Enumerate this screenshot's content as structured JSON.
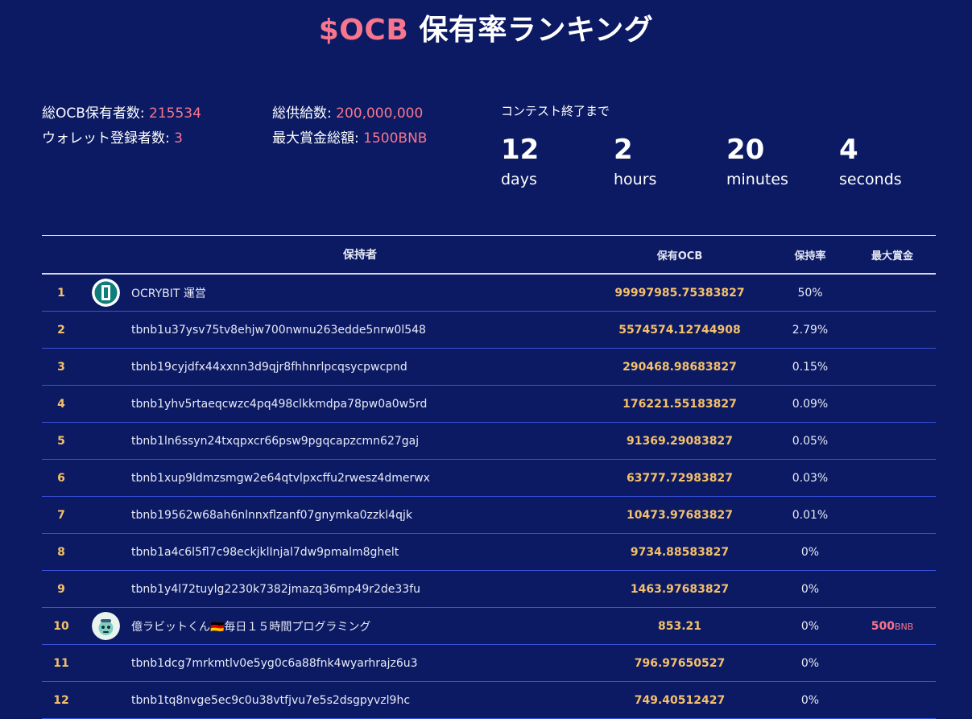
{
  "header": {
    "title_accent": "$OCB",
    "title_rest": "保有率ランキング"
  },
  "stats": {
    "total_holders_label": "総OCB保有者数: ",
    "total_holders_value": "215534",
    "wallet_registered_label": "ウォレット登録者数: ",
    "wallet_registered_value": "3",
    "total_supply_label": "総供給数: ",
    "total_supply_value": "200,000,000",
    "max_prize_label": "最大賞金総額: ",
    "max_prize_value": "1500BNB"
  },
  "countdown": {
    "label": "コンテスト終了まで",
    "units": [
      {
        "num": "12",
        "name": "days"
      },
      {
        "num": "2",
        "name": "hours"
      },
      {
        "num": "20",
        "name": "minutes"
      },
      {
        "num": "4",
        "name": "seconds"
      }
    ]
  },
  "table": {
    "headers": {
      "holder": "保持者",
      "holding": "保有OCB",
      "rate": "保持率",
      "prize": "最大賞金"
    },
    "rows": [
      {
        "rank": "1",
        "avatar": "ocrybit-logo-icon",
        "name": "OCRYBIT 運営",
        "holding": "99997985.75383827",
        "rate": "50%",
        "prize_amount": "",
        "prize_currency": ""
      },
      {
        "rank": "2",
        "avatar": "",
        "name": "tbnb1u37ysv75tv8ehjw700nwnu263edde5nrw0l548",
        "holding": "5574574.12744908",
        "rate": "2.79%",
        "prize_amount": "",
        "prize_currency": ""
      },
      {
        "rank": "3",
        "avatar": "",
        "name": "tbnb19cyjdfx44xxnn3d9qjr8fhhnrlpcqsycpwcpnd",
        "holding": "290468.98683827",
        "rate": "0.15%",
        "prize_amount": "",
        "prize_currency": ""
      },
      {
        "rank": "4",
        "avatar": "",
        "name": "tbnb1yhv5rtaeqcwzc4pq498clkkmdpa78pw0a0w5rd",
        "holding": "176221.55183827",
        "rate": "0.09%",
        "prize_amount": "",
        "prize_currency": ""
      },
      {
        "rank": "5",
        "avatar": "",
        "name": "tbnb1ln6ssyn24txqpxcr66psw9pgqcapzcmn627gaj",
        "holding": "91369.29083827",
        "rate": "0.05%",
        "prize_amount": "",
        "prize_currency": ""
      },
      {
        "rank": "6",
        "avatar": "",
        "name": "tbnb1xup9ldmzsmgw2e64qtvlpxcffu2rwesz4dmerwx",
        "holding": "63777.72983827",
        "rate": "0.03%",
        "prize_amount": "",
        "prize_currency": ""
      },
      {
        "rank": "7",
        "avatar": "",
        "name": "tbnb19562w68ah6nlnnxflzanf07gnymka0zzkl4qjk",
        "holding": "10473.97683827",
        "rate": "0.01%",
        "prize_amount": "",
        "prize_currency": ""
      },
      {
        "rank": "8",
        "avatar": "",
        "name": "tbnb1a4c6l5fl7c98eckjklInjal7dw9pmalm8ghelt",
        "holding": "9734.88583827",
        "rate": "0%",
        "prize_amount": "",
        "prize_currency": ""
      },
      {
        "rank": "9",
        "avatar": "",
        "name": "tbnb1y4l72tuylg2230k7382jmazq36mp49r2de33fu",
        "holding": "1463.97683827",
        "rate": "0%",
        "prize_amount": "",
        "prize_currency": ""
      },
      {
        "rank": "10",
        "avatar": "rabbit-avatar-icon",
        "name": "億ラビットくん🇩🇪毎日１５時間プログラミング",
        "holding": "853.21",
        "rate": "0%",
        "prize_amount": "500",
        "prize_currency": "BNB"
      },
      {
        "rank": "11",
        "avatar": "",
        "name": "tbnb1dcg7mrkmtlv0e5yg0c6a88fnk4wyarhrajz6u3",
        "holding": "796.97650527",
        "rate": "0%",
        "prize_amount": "",
        "prize_currency": ""
      },
      {
        "rank": "12",
        "avatar": "",
        "name": "tbnb1tq8nvge5ec9c0u38vtfjvu7e5s2dsgpyvzl9hc",
        "holding": "749.40512427",
        "rate": "0%",
        "prize_amount": "",
        "prize_currency": ""
      }
    ]
  },
  "colors": {
    "background": "#0b1a63",
    "accent_pink": "#f7768e",
    "holding_gold": "#f5c06a",
    "row_border": "#3a52d9"
  }
}
